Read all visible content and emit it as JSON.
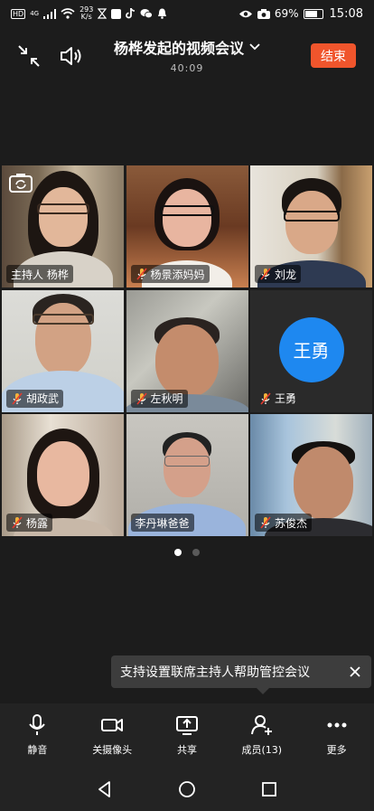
{
  "status_bar": {
    "hd": "HD",
    "network": "4G",
    "speed_value": "293",
    "speed_unit": "K/s",
    "battery": "69%",
    "time": "15:08"
  },
  "header": {
    "title": "杨桦发起的视频会议",
    "timer": "40:09",
    "end_label": "结束"
  },
  "participants": [
    {
      "name": "主持人  杨桦",
      "muted": false,
      "video": true,
      "cam_switch": true
    },
    {
      "name": "杨景添妈妈",
      "muted": true,
      "video": true
    },
    {
      "name": "刘龙",
      "muted": true,
      "video": true
    },
    {
      "name": "胡政武",
      "muted": true,
      "video": true
    },
    {
      "name": "左秋明",
      "muted": true,
      "video": true
    },
    {
      "name": "王勇",
      "muted": true,
      "video": false,
      "avatar_text": "王勇"
    },
    {
      "name": "杨露",
      "muted": true,
      "video": true
    },
    {
      "name": "李丹琳爸爸",
      "muted": false,
      "video": true
    },
    {
      "name": "苏俊杰",
      "muted": true,
      "video": true
    }
  ],
  "pager": {
    "pages": 2,
    "current": 1
  },
  "tip": {
    "text": "支持设置联席主持人帮助管控会议"
  },
  "toolbar": {
    "mute": "静音",
    "camera_off": "关摄像头",
    "share": "共享",
    "members": "成员(13)",
    "more": "更多"
  },
  "colors": {
    "accent": "#1e88f0",
    "end": "#f0552c",
    "background": "#1c1c1c"
  }
}
